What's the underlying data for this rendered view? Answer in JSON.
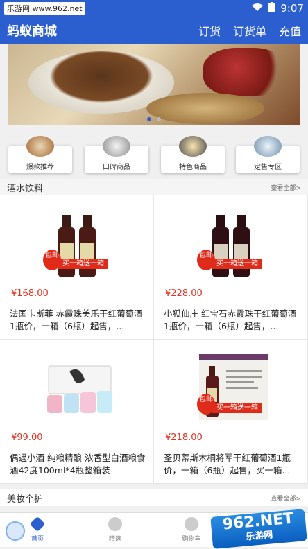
{
  "status": {
    "source": "乐游网 www.962.net",
    "time": "9:07"
  },
  "app": {
    "title": "蚂蚁商城",
    "actions": [
      "订货",
      "订货单",
      "充值"
    ]
  },
  "quick": [
    {
      "label": "爆款推荐"
    },
    {
      "label": "口碑商品"
    },
    {
      "label": "特色商品"
    },
    {
      "label": "定售专区"
    }
  ],
  "sections": [
    {
      "title": "酒水饮料",
      "more": "查看全部>"
    },
    {
      "title": "美妆个护",
      "more": "查看全部>"
    }
  ],
  "products": [
    {
      "price": "¥168.00",
      "name": "法国卡斯菲 赤霞珠美乐干红葡萄酒1瓶价，一箱（6瓶）起售，...",
      "badge": "包邮",
      "ribbon": "买一箱送一箱"
    },
    {
      "price": "¥228.00",
      "name": "小狐仙庄 红宝石赤霞珠干红葡萄酒1瓶价，一箱（6瓶）起售，...",
      "badge": "包邮",
      "ribbon": "买一箱送一箱"
    },
    {
      "price": "¥99.00",
      "name": "偶遇小酒 纯粮精酿 浓香型白酒粮食酒42度100ml*4瓶整箱装",
      "badge": "",
      "ribbon": ""
    },
    {
      "price": "¥218.00",
      "name": "圣贝蒂斯木桐将军干红葡萄酒1瓶价，一箱（6瓶）起售，买一箱...",
      "badge": "包邮",
      "ribbon": "买一箱送一箱"
    }
  ],
  "nav": [
    "首页",
    "精选",
    "购物车"
  ],
  "watermark": {
    "main": "962.NET",
    "sub": "乐游网"
  },
  "colors": {
    "primary": "#2b5fd0",
    "price": "#e03020"
  }
}
